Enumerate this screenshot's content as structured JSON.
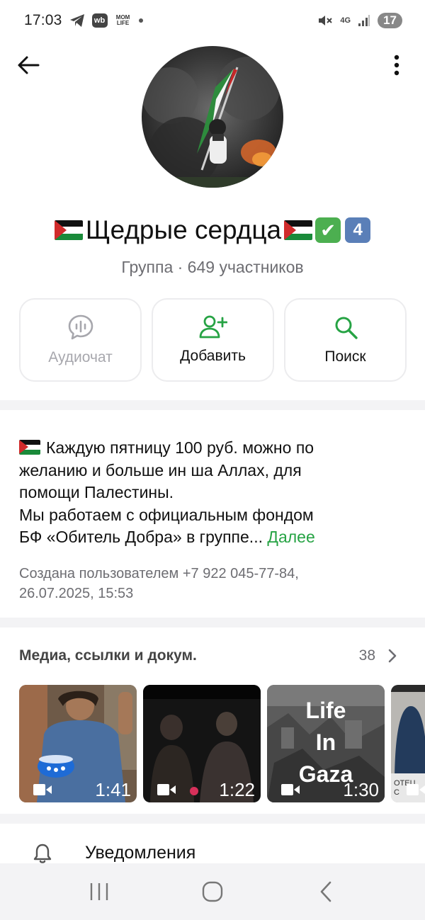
{
  "status_bar": {
    "time": "17:03",
    "icons": [
      "telegram-icon",
      "wb-icon",
      "mom-life-icon",
      "dot-icon"
    ],
    "wb_label": "wb",
    "mom_label": "MOM LIFE",
    "network_label": "4G",
    "battery": "17"
  },
  "header": {
    "back_icon": "arrow-left-icon",
    "more_icon": "more-vertical-icon",
    "title": "Щедрые сердца",
    "check_badge": "✔",
    "number_badge": "4",
    "subtitle": "Группа · 649 участников"
  },
  "actions": [
    {
      "label": "Аудиочат",
      "icon": "audio-chat-icon",
      "enabled": false
    },
    {
      "label": "Добавить",
      "icon": "add-user-icon",
      "enabled": true
    },
    {
      "label": "Поиск",
      "icon": "search-icon",
      "enabled": true
    }
  ],
  "about": {
    "lines": [
      "Каждую пятницу 100 руб. можно по",
      "желанию и больше ин ша Аллах, для",
      "помощи Палестины.",
      "Мы работаем с официальным фондом",
      "БФ «Обитель Добра» в группе..."
    ],
    "more_link": "Далее",
    "created_line1": "Создана пользователем +7 922 045-77-84,",
    "created_line2": "26.07.2025, 15:53"
  },
  "media": {
    "title": "Медиа, ссылки и докум.",
    "count": "38",
    "items": [
      {
        "duration": "1:41",
        "overlay": ""
      },
      {
        "duration": "1:22",
        "overlay": ""
      },
      {
        "duration": "1:30",
        "overlay": "Life In Gaza"
      },
      {
        "duration": "",
        "overlay": "ОТЕЦ С"
      }
    ]
  },
  "notifications": {
    "label": "Уведомления",
    "icon": "bell-icon"
  },
  "colors": {
    "accent": "#26a344",
    "muted": "#6d6d72",
    "disabled": "#a7a7ad"
  }
}
